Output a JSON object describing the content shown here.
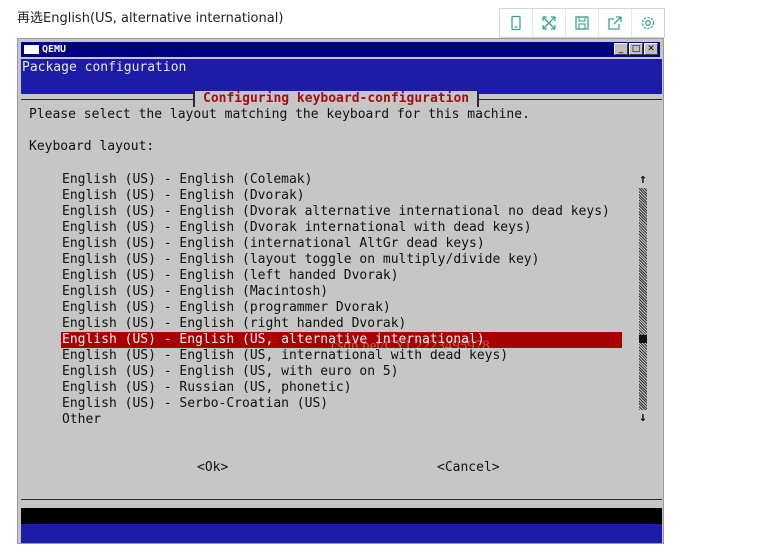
{
  "caption": "再选English(US, alternative international)",
  "toolbar": {
    "icons": [
      "mobile-icon",
      "fullscreen-icon",
      "save-icon",
      "share-icon",
      "settings-icon"
    ]
  },
  "window": {
    "title": "QEMU",
    "controls": {
      "minimize": "_",
      "maximize": "□",
      "close": "✕"
    }
  },
  "screen": {
    "heading": "Package configuration",
    "dialog_title": "Configuring keyboard-configuration",
    "instruction": "Please select the layout matching the keyboard for this machine.",
    "field_label": "Keyboard layout:",
    "options": [
      "English (US) - English (Colemak)",
      "English (US) - English (Dvorak)",
      "English (US) - English (Dvorak alternative international no dead keys)",
      "English (US) - English (Dvorak international with dead keys)",
      "English (US) - English (international AltGr dead keys)",
      "English (US) - English (layout toggle on multiply/divide key)",
      "English (US) - English (left handed Dvorak)",
      "English (US) - English (Macintosh)",
      "English (US) - English (programmer Dvorak)",
      "English (US) - English (right handed Dvorak)",
      "English (US) - English (US, alternative international)",
      "English (US) - English (US, international with dead keys)",
      "English (US) - English (US, with euro on 5)",
      "English (US) - Russian (US, phonetic)",
      "English (US) - Serbo-Croatian (US)",
      "Other"
    ],
    "selected_index": 10,
    "scroll_up": "↑",
    "scroll_down": "↓",
    "ok_label": "<Ok>",
    "cancel_label": "<Cancel>",
    "watermark": "csdn.net/CYL2223495978"
  },
  "colors": {
    "title_blue": "#000080",
    "screen_blue": "#1c1ca8",
    "dialog_gray": "#c6c6c6",
    "selection_red": "#a80000",
    "dialog_title_red": "#a01010"
  }
}
